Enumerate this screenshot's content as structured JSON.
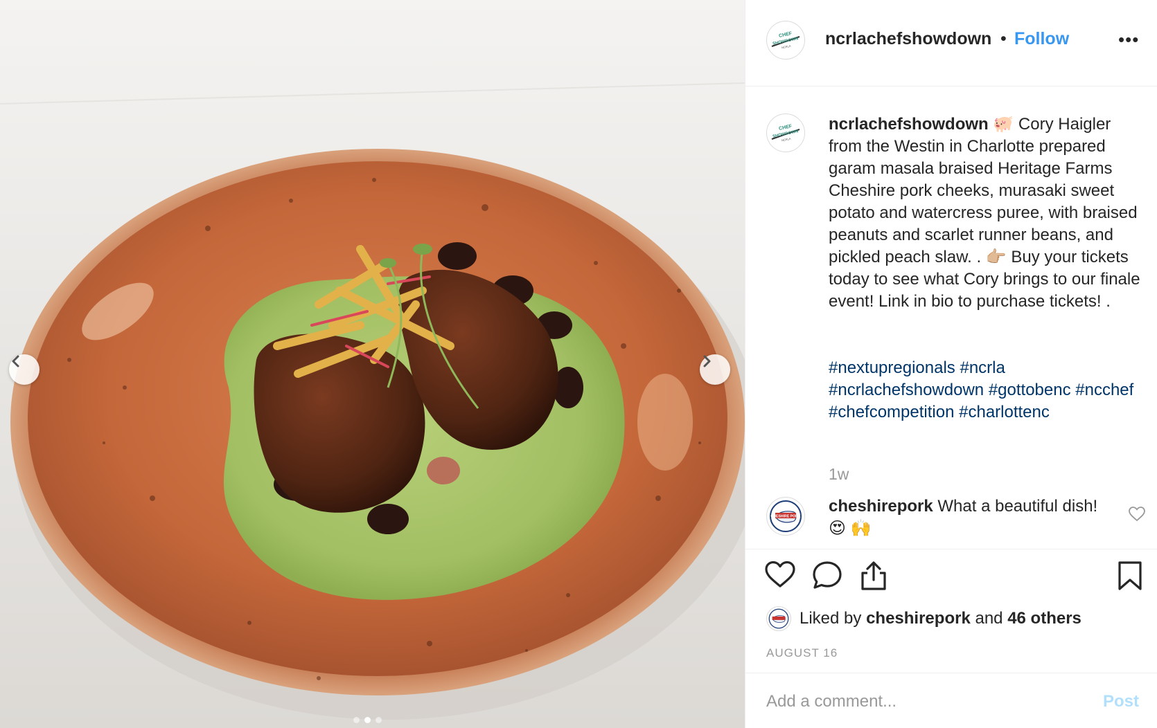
{
  "header": {
    "username": "ncrlachefshowdown",
    "separator": "•",
    "follow_label": "Follow",
    "more_label": "•••",
    "avatar_logo_lines": [
      "CHEF",
      "SHOWDOWN",
      "NCRLA"
    ]
  },
  "caption": {
    "username": "ncrlachefshowdown",
    "text_1": " 🐖 Cory Haigler from the Westin in Charlotte prepared garam masala braised Heritage Farms Cheshire pork cheeks, murasaki sweet potato and watercress puree, with braised peanuts and scarlet runner beans, and pickled peach slaw. . 👉🏼 Buy your tickets today to see what Cory brings to our finale event! Link in bio to purchase tickets! .",
    "hashtags": [
      "#nextupregionals",
      "#ncrla",
      "#ncrlachefshowdown",
      "#gottobenc",
      "#ncchef",
      "#chefcompetition",
      "#charlottenc"
    ],
    "age": "1w"
  },
  "comment": {
    "username": "cheshirepork",
    "text": " What a beautiful dish! 😍 🙌",
    "avatar_logo": "CHESHIRE PORK"
  },
  "actions": {
    "like_icon": "heart-icon",
    "comment_icon": "speech-bubble-icon",
    "share_icon": "share-icon",
    "save_icon": "bookmark-icon"
  },
  "likes": {
    "prefix": "Liked by ",
    "user": "cheshirepork",
    "middle": " and ",
    "others": "46 others"
  },
  "date": "AUGUST 16",
  "add_comment": {
    "placeholder": "Add a comment...",
    "post_label": "Post"
  },
  "media": {
    "carousel_total": 3,
    "carousel_active": 2,
    "prev_icon": "chevron-left-icon",
    "next_icon": "chevron-right-icon"
  },
  "colors": {
    "link_blue": "#3897f0",
    "hashtag_blue": "#003569",
    "muted_gray": "#999999",
    "post_disabled": "#b2dffc",
    "plate_orange": "#c86a3c",
    "puree_green": "#a9c46a"
  }
}
